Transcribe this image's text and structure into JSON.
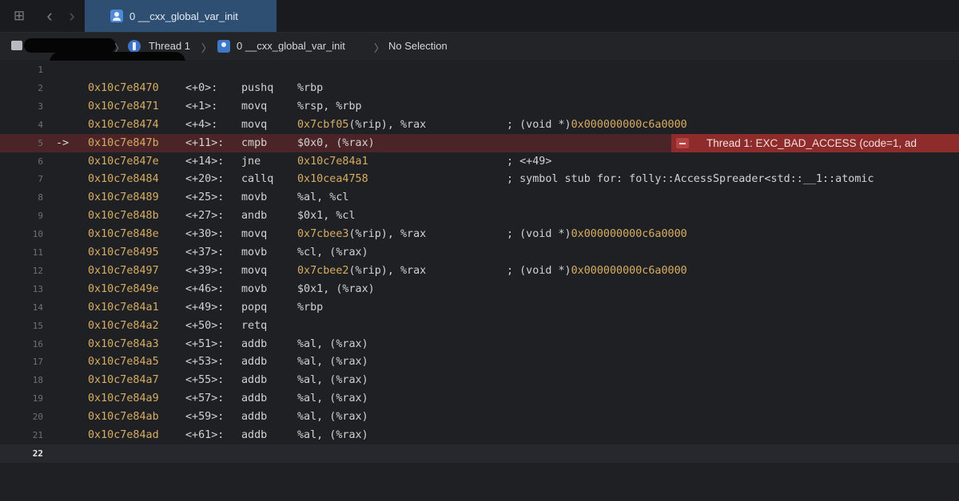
{
  "tab": {
    "title": "0 __cxx_global_var_init"
  },
  "jumpbar": {
    "thread": "Thread 1",
    "frame": "0 __cxx_global_var_init",
    "selection": "No Selection"
  },
  "error_badge": {
    "text": "Thread 1: EXC_BAD_ACCESS (code=1, ad"
  },
  "lines": [
    {
      "n": "1",
      "addr": "",
      "off": "",
      "op": "",
      "args": "",
      "cmt": "",
      "cmt_hex": ""
    },
    {
      "n": "2",
      "addr": "0x10c7e8470",
      "off": "<+0>:",
      "op": "pushq",
      "args": "%rbp",
      "cmt": "",
      "cmt_hex": ""
    },
    {
      "n": "3",
      "addr": "0x10c7e8471",
      "off": "<+1>:",
      "op": "movq",
      "args": "%rsp, %rbp",
      "cmt": "",
      "cmt_hex": ""
    },
    {
      "n": "4",
      "addr": "0x10c7e8474",
      "off": "<+4>:",
      "op": "movq",
      "args": "0x7cbf05(%rip), %rax",
      "args_hex": "0x7cbf05",
      "cmt": "; (void *)",
      "cmt_hex": "0x000000000c6a0000"
    },
    {
      "n": "5",
      "addr": "0x10c7e847b",
      "off": "<+11>:",
      "op": "cmpb",
      "args": "$0x0, (%rax)",
      "cmt": "",
      "cmt_hex": "",
      "current": true,
      "arrow": "->"
    },
    {
      "n": "6",
      "addr": "0x10c7e847e",
      "off": "<+14>:",
      "op": "jne",
      "args": "0x10c7e84a1",
      "args_hex": "0x10c7e84a1",
      "cmt": "; <+49>",
      "cmt_hex": ""
    },
    {
      "n": "7",
      "addr": "0x10c7e8484",
      "off": "<+20>:",
      "op": "callq",
      "args": "0x10cea4758",
      "args_hex": "0x10cea4758",
      "cmt": "; symbol stub for: folly::AccessSpreader<std::__1::atomic",
      "cmt_hex": ""
    },
    {
      "n": "8",
      "addr": "0x10c7e8489",
      "off": "<+25>:",
      "op": "movb",
      "args": "%al, %cl",
      "cmt": "",
      "cmt_hex": ""
    },
    {
      "n": "9",
      "addr": "0x10c7e848b",
      "off": "<+27>:",
      "op": "andb",
      "args": "$0x1, %cl",
      "cmt": "",
      "cmt_hex": ""
    },
    {
      "n": "10",
      "addr": "0x10c7e848e",
      "off": "<+30>:",
      "op": "movq",
      "args": "0x7cbee3(%rip), %rax",
      "args_hex": "0x7cbee3",
      "cmt": "; (void *)",
      "cmt_hex": "0x000000000c6a0000"
    },
    {
      "n": "11",
      "addr": "0x10c7e8495",
      "off": "<+37>:",
      "op": "movb",
      "args": "%cl, (%rax)",
      "cmt": "",
      "cmt_hex": ""
    },
    {
      "n": "12",
      "addr": "0x10c7e8497",
      "off": "<+39>:",
      "op": "movq",
      "args": "0x7cbee2(%rip), %rax",
      "args_hex": "0x7cbee2",
      "cmt": "; (void *)",
      "cmt_hex": "0x000000000c6a0000"
    },
    {
      "n": "13",
      "addr": "0x10c7e849e",
      "off": "<+46>:",
      "op": "movb",
      "args": "$0x1, (%rax)",
      "cmt": "",
      "cmt_hex": ""
    },
    {
      "n": "14",
      "addr": "0x10c7e84a1",
      "off": "<+49>:",
      "op": "popq",
      "args": "%rbp",
      "cmt": "",
      "cmt_hex": ""
    },
    {
      "n": "15",
      "addr": "0x10c7e84a2",
      "off": "<+50>:",
      "op": "retq",
      "args": "",
      "cmt": "",
      "cmt_hex": ""
    },
    {
      "n": "16",
      "addr": "0x10c7e84a3",
      "off": "<+51>:",
      "op": "addb",
      "args": "%al, (%rax)",
      "cmt": "",
      "cmt_hex": ""
    },
    {
      "n": "17",
      "addr": "0x10c7e84a5",
      "off": "<+53>:",
      "op": "addb",
      "args": "%al, (%rax)",
      "cmt": "",
      "cmt_hex": ""
    },
    {
      "n": "18",
      "addr": "0x10c7e84a7",
      "off": "<+55>:",
      "op": "addb",
      "args": "%al, (%rax)",
      "cmt": "",
      "cmt_hex": ""
    },
    {
      "n": "19",
      "addr": "0x10c7e84a9",
      "off": "<+57>:",
      "op": "addb",
      "args": "%al, (%rax)",
      "cmt": "",
      "cmt_hex": ""
    },
    {
      "n": "20",
      "addr": "0x10c7e84ab",
      "off": "<+59>:",
      "op": "addb",
      "args": "%al, (%rax)",
      "cmt": "",
      "cmt_hex": ""
    },
    {
      "n": "21",
      "addr": "0x10c7e84ad",
      "off": "<+61>:",
      "op": "addb",
      "args": "%al, (%rax)",
      "cmt": "",
      "cmt_hex": ""
    },
    {
      "n": "22",
      "addr": "",
      "off": "",
      "op": "",
      "args": "",
      "cmt": "",
      "cmt_hex": "",
      "cursor": true
    }
  ]
}
